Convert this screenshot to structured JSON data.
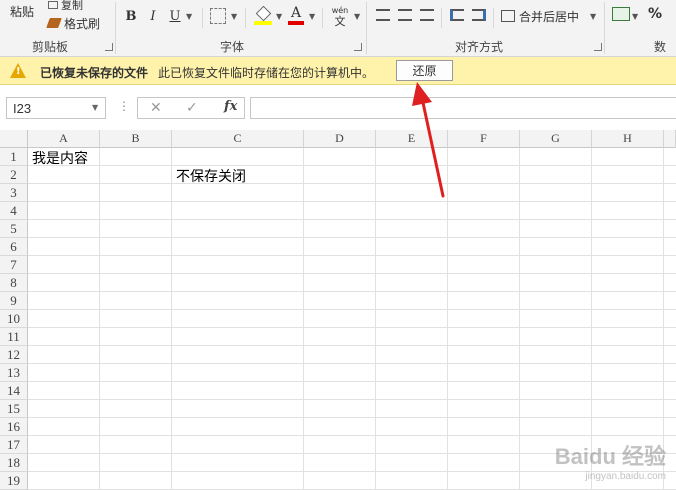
{
  "ribbon": {
    "clipboard": {
      "paste": "粘贴",
      "copy": "复制",
      "format_painter": "格式刷",
      "group_label": "剪贴板"
    },
    "font": {
      "bold": "B",
      "italic": "I",
      "underline": "U",
      "font_color_letter": "A",
      "phonetic_top": "wén",
      "phonetic_bottom": "文",
      "group_label": "字体"
    },
    "alignment": {
      "merge_center": "合并后居中",
      "group_label": "对齐方式"
    },
    "number": {
      "percent": "%",
      "group_label": "数字"
    }
  },
  "message_bar": {
    "title": "已恢复未保存的文件",
    "text": "此已恢复文件临时存储在您的计算机中。",
    "restore_button": "还原"
  },
  "formula_bar": {
    "name_box": "I23",
    "fx": "fx",
    "cancel": "✕",
    "enter": "✓"
  },
  "columns": [
    "A",
    "B",
    "C",
    "D",
    "E",
    "F",
    "G",
    "H"
  ],
  "rows": [
    "1",
    "2",
    "3",
    "4",
    "5",
    "6",
    "7",
    "8",
    "9",
    "10",
    "11",
    "12",
    "13",
    "14",
    "15",
    "16",
    "17",
    "18",
    "19"
  ],
  "cells": {
    "A1": "我是内容",
    "C2": "不保存关闭"
  },
  "watermark": "Baidu 经验",
  "watermark_url": "jingyan.baidu.com",
  "colors": {
    "arrow": "#e02020",
    "message_bar": "#fff2ab",
    "warning_icon": "#e6a700"
  }
}
